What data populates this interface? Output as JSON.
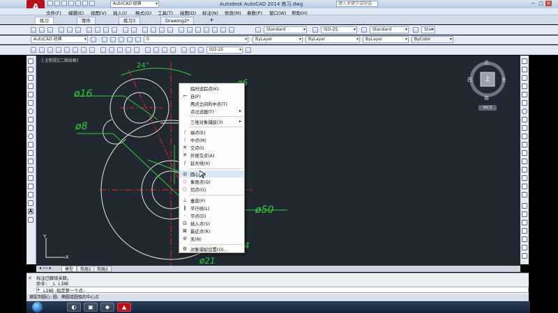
{
  "window": {
    "app_logo": "A",
    "title": "Autodesk AutoCAD 2014   练习.dwg",
    "search_placeholder": "键入关键字或短语",
    "workspace": "AutoCAD 经典"
  },
  "menubar": {
    "items": [
      "文件(F)",
      "编辑(E)",
      "视图(V)",
      "插入(I)",
      "格式(O)",
      "工具(T)",
      "绘图(D)",
      "标注(N)",
      "修改(M)",
      "参数(P)",
      "窗口(W)",
      "帮助(H)"
    ]
  },
  "doc_tabs": [
    "练习",
    "零件",
    "练习3",
    "Drawing2*"
  ],
  "toolbars": {
    "workspace_combo": "AutoCAD 经典",
    "text_style": "Standard",
    "dim_style": "ISO-25",
    "table_style": "Standard",
    "ml_style": "Stan",
    "layer_combo": "0",
    "color_combo": "ByLayer",
    "linetype_combo": "ByLayer",
    "lineweight_combo": "ByLayer",
    "plotstyle_combo": "ByColor",
    "dimstyle_combo2": "ISO-25"
  },
  "viewport_label": "[-][俯视][二维线框]",
  "drawing": {
    "dim_angle": "24°",
    "dim_d16": "ø16",
    "dim_d8": "ø8",
    "dim_d50": "ø50",
    "dim_d21": "ø21",
    "dim_partial": "ø6",
    "dim_partial2": "4",
    "ucs_y": "Y",
    "ucs_x": "X"
  },
  "viewcube": {
    "north": "北",
    "south": "南",
    "east": "东",
    "west": "西",
    "top": "上",
    "wcs": "WCS"
  },
  "context_menu": {
    "items": [
      {
        "icon": "",
        "label": "临时追踪点(K)"
      },
      {
        "icon": "⌐",
        "label": "自(F)"
      },
      {
        "icon": "",
        "label": "两点之间的中点(T)"
      },
      {
        "icon": "",
        "label": "点过滤器(T)",
        "submenu": true
      },
      {
        "icon": "",
        "label": "三维对象捕捉(3)",
        "submenu": true
      },
      {
        "icon": "∕",
        "label": "端点(E)"
      },
      {
        "icon": "∕",
        "label": "中点(M)"
      },
      {
        "icon": "✕",
        "label": "交点(I)"
      },
      {
        "icon": "✕",
        "label": "外观交点(A)"
      },
      {
        "icon": "∕",
        "label": "延长线(X)"
      },
      {
        "icon": "◎",
        "label": "圆心(C)"
      },
      {
        "icon": "◇",
        "label": "象限点(Q)"
      },
      {
        "icon": "○",
        "label": "切点(G)"
      },
      {
        "icon": "⊥",
        "label": "垂直(P)"
      },
      {
        "icon": "∥",
        "label": "平行线(L)"
      },
      {
        "icon": "·",
        "label": "节点(D)"
      },
      {
        "icon": "⊡",
        "label": "插入点(S)"
      },
      {
        "icon": "⊠",
        "label": "最近点(R)"
      },
      {
        "icon": "⊘",
        "label": "无(N)"
      },
      {
        "icon": "⚙",
        "label": "对象捕捉设置(O)..."
      }
    ]
  },
  "layout_tabs": [
    "模型",
    "布局1",
    "布局2"
  ],
  "command": {
    "history1": "标注已解除关联。",
    "history2": "命令: _L LINE",
    "prompt": "LINE 指定第一个点:"
  },
  "statusbar": {
    "text": "捕捉到圆心: 圆、椭圆或圆弧的中心点"
  },
  "taskbar": {
    "clock": "",
    "apps": [
      "◐",
      "▣",
      "◆",
      "▲"
    ]
  },
  "colors": {
    "canvas": "#212830",
    "dimension": "#2ecc40",
    "geometry": "#e6e6e6",
    "centerline": "#e0242a",
    "accent": "#b8121b"
  }
}
